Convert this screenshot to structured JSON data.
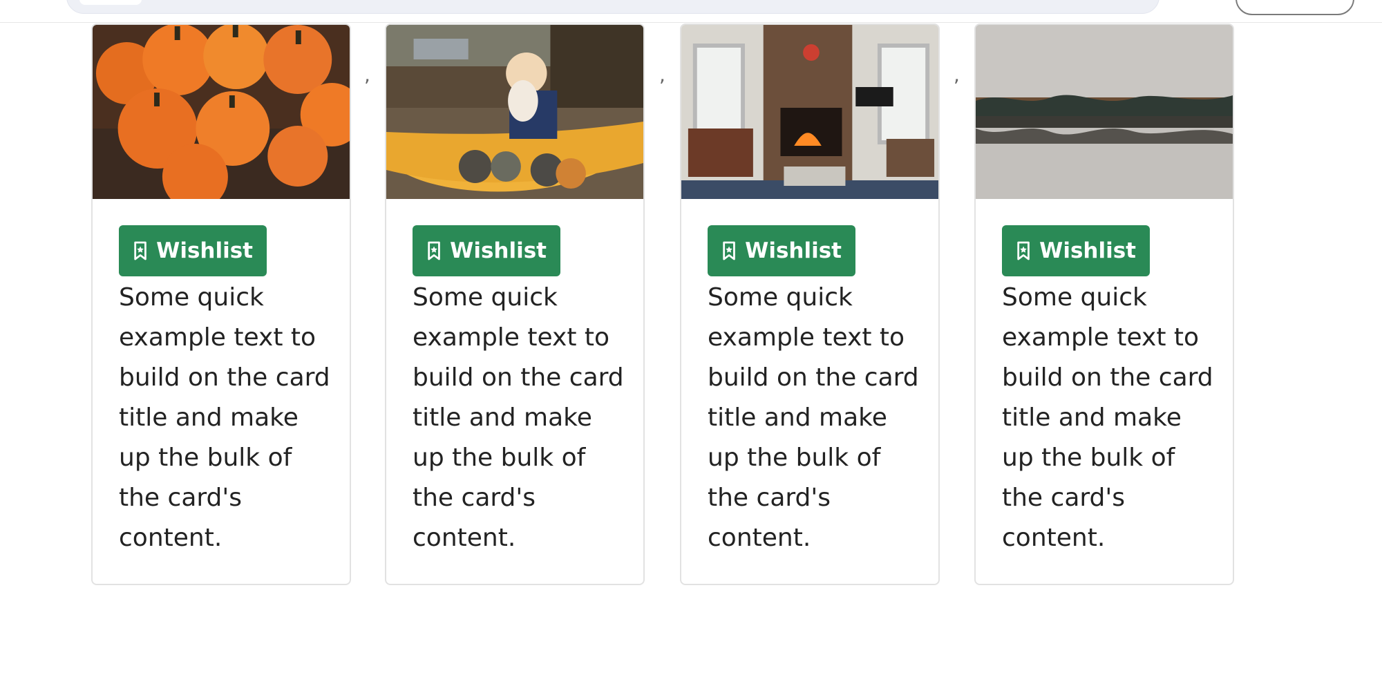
{
  "cards": [
    {
      "image_semantics": "pumpkins",
      "button_label": "Wishlist",
      "text": "Some quick example text to build on the card title and make up the bulk of the card's content."
    },
    {
      "image_semantics": "child-in-wheelbarrow",
      "button_label": "Wishlist",
      "text": "Some quick example text to build on the card title and make up the bulk of the card's content."
    },
    {
      "image_semantics": "fireplace-living-room",
      "button_label": "Wishlist",
      "text": "Some quick example text to build on the card title and make up the bulk of the card's content."
    },
    {
      "image_semantics": "lake-reflection",
      "button_label": "Wishlist",
      "text": "Some quick example text to build on the card title and make up the bulk of the card's content."
    }
  ],
  "separators": [
    ",",
    ",",
    ","
  ],
  "colors": {
    "button_green": "#2a8a56",
    "card_border": "#e2e2e2",
    "text": "#222222"
  }
}
